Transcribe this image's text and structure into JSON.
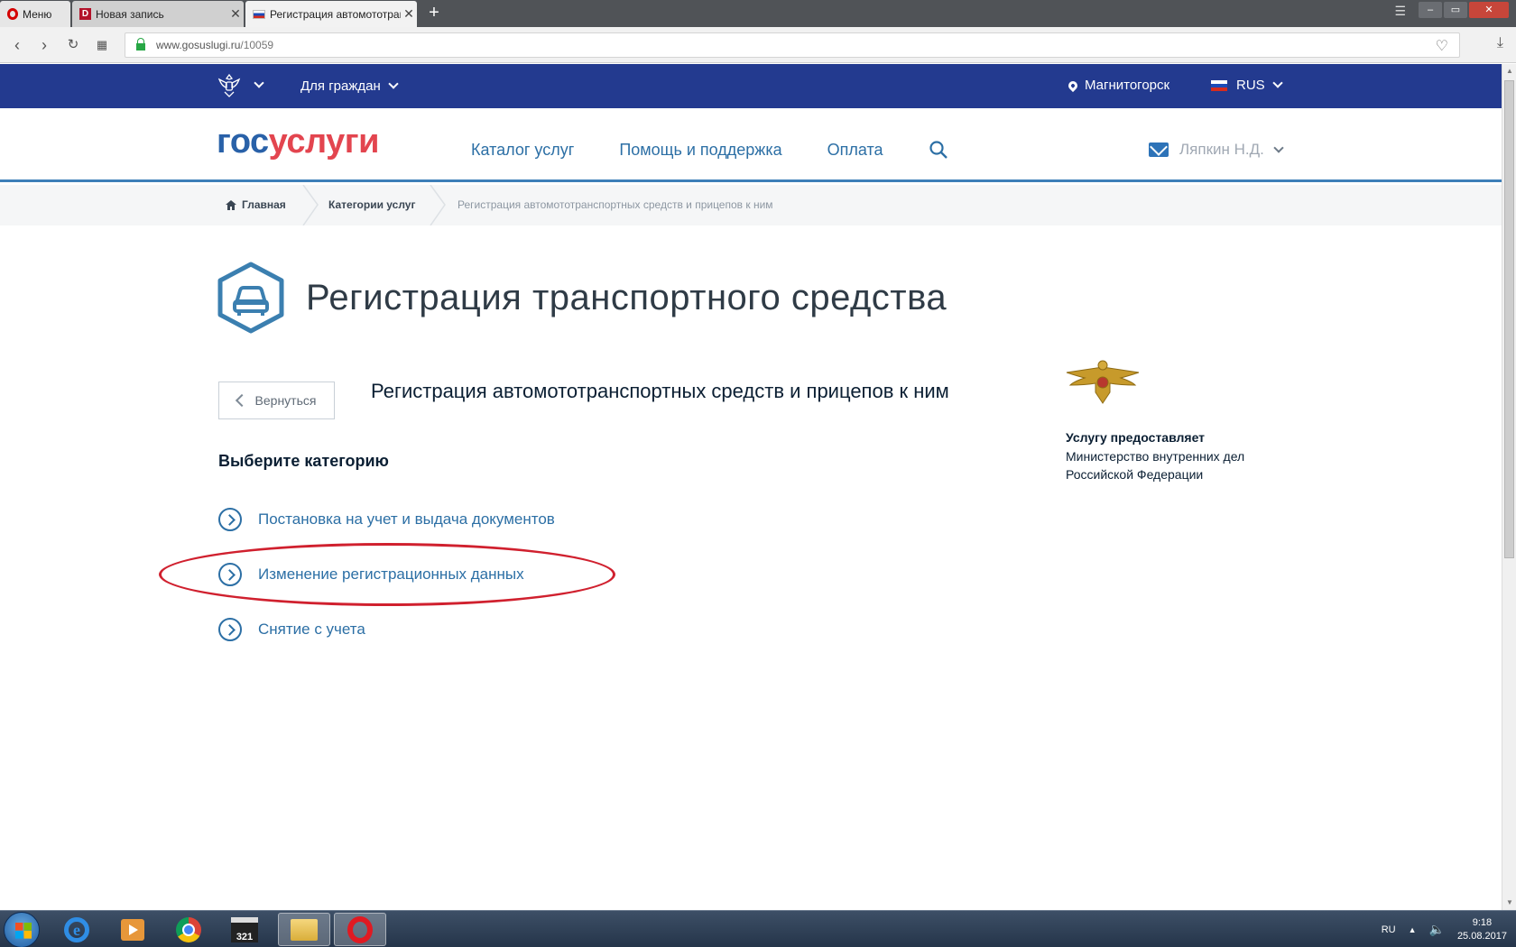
{
  "browser": {
    "menu_label": "Меню",
    "tabs": [
      {
        "title": "Новая запись"
      },
      {
        "title": "Регистрация автомототранспортных"
      }
    ],
    "url_host": "www.gosuslugi.ru",
    "url_path": "/10059"
  },
  "topbar": {
    "citizens_label": "Для граждан",
    "city": "Магнитогорск",
    "lang": "RUS"
  },
  "header": {
    "logo_gos": "гос",
    "logo_usl": "услуги",
    "nav": [
      "Каталог услуг",
      "Помощь и поддержка",
      "Оплата"
    ],
    "user_name": "Ляпкин Н.Д."
  },
  "breadcrumbs": {
    "home": "Главная",
    "categories": "Категории услуг",
    "current": "Регистрация автомототранспортных средств и прицепов к ним"
  },
  "page": {
    "title": "Регистрация транспортного средства",
    "back_label": "Вернуться",
    "subtitle": "Регистрация автомототранспортных средств и прицепов к ним",
    "choose_label": "Выберите категорию",
    "categories": [
      "Постановка на учет и выдача документов",
      "Изменение регистрационных данных",
      "Снятие с учета"
    ],
    "provider_label": "Услугу предоставляет",
    "provider_name": "Министерство внутренних дел Российской Федерации"
  },
  "taskbar": {
    "lang": "RU",
    "time": "9:18",
    "date": "25.08.2017",
    "media_badge": "321"
  },
  "colors": {
    "gov_blue": "#233a8f",
    "link_blue": "#2c6fa5",
    "logo_red": "#e3454f",
    "highlight_red": "#d0202e"
  }
}
